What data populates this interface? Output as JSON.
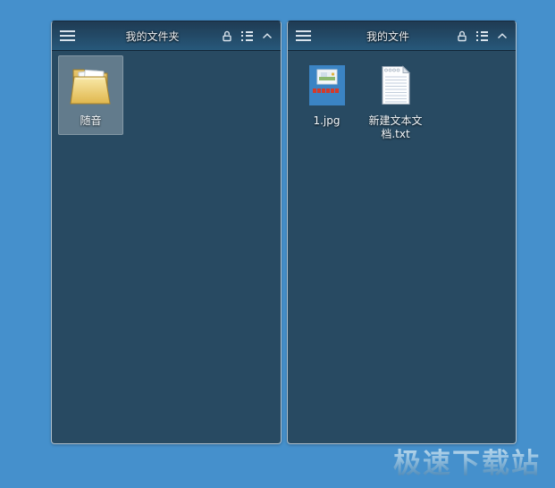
{
  "app": {
    "watermark": "极速下载站"
  },
  "colors": {
    "desktop_background": "#4590cc",
    "panel_background": "#284a62",
    "header_gradient_top": "#1f3b53",
    "header_gradient_bottom": "#27587a",
    "icon_color": "#d9e3ec",
    "selection_fill": "rgba(255,255,255,0.27)"
  },
  "titlebar_icons": {
    "menu": "hamburger-menu",
    "lock": "unlock-open-padlock",
    "view": "list-view",
    "collapse": "chevron-up"
  },
  "panels": [
    {
      "title": "我的文件夹",
      "items": [
        {
          "label": "随音",
          "type": "folder",
          "selected": true
        }
      ]
    },
    {
      "title": "我的文件",
      "items": [
        {
          "label": "1.jpg",
          "type": "image-file"
        },
        {
          "label": "新建文本文档.txt",
          "type": "text-file"
        }
      ]
    }
  ]
}
